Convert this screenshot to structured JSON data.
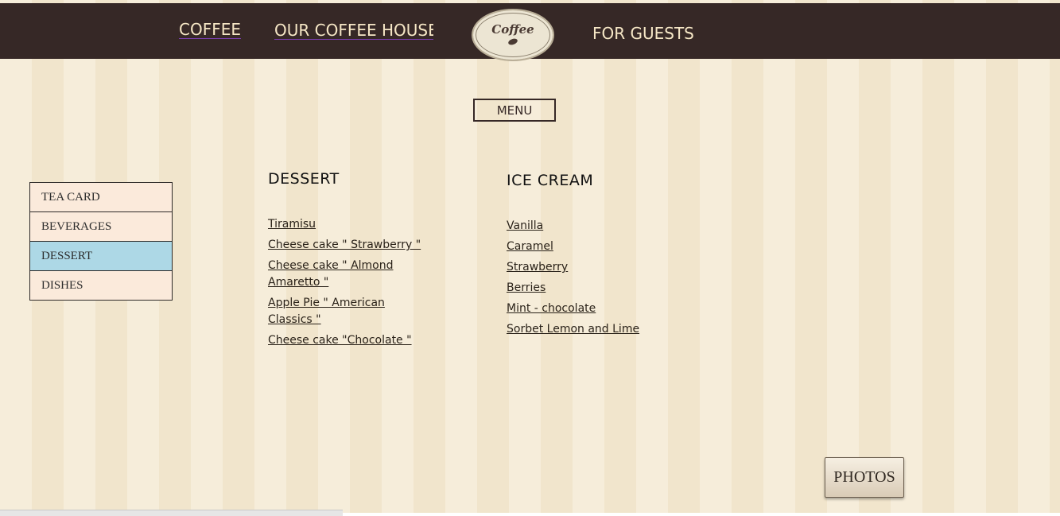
{
  "nav": {
    "coffee": "COFFEE",
    "coffee_house": "OUR COFFEE HOUSE",
    "for_guests": "FOR GUESTS"
  },
  "logo": {
    "text": "Coffee",
    "icon": "coffee-bean-icon"
  },
  "menu_button": "MENU",
  "sidebar": {
    "items": [
      {
        "label": "TEA CARD"
      },
      {
        "label": "BEVERAGES"
      },
      {
        "label": "DESSERT"
      },
      {
        "label": "DISHES"
      }
    ],
    "active": "DESSERT"
  },
  "dessert": {
    "title": "DESSERT",
    "items": [
      "Tiramisu",
      "Cheese cake \" Strawberry \"",
      "Cheese cake \" Almond Amaretto \"",
      "Apple Pie \" American Classics \"",
      "Cheese cake \"Chocolate \""
    ]
  },
  "ice_cream": {
    "title": "ICE CREAM",
    "items": [
      "Vanilla",
      "Caramel",
      "Strawberry",
      "Berries",
      "Mint - chocolate",
      "Sorbet Lemon and Lime"
    ]
  },
  "photos_button": "PHOTOS",
  "colors": {
    "header_bg": "#362826",
    "page_bg": "#f4e9d2",
    "active_item": "#add8e6"
  }
}
